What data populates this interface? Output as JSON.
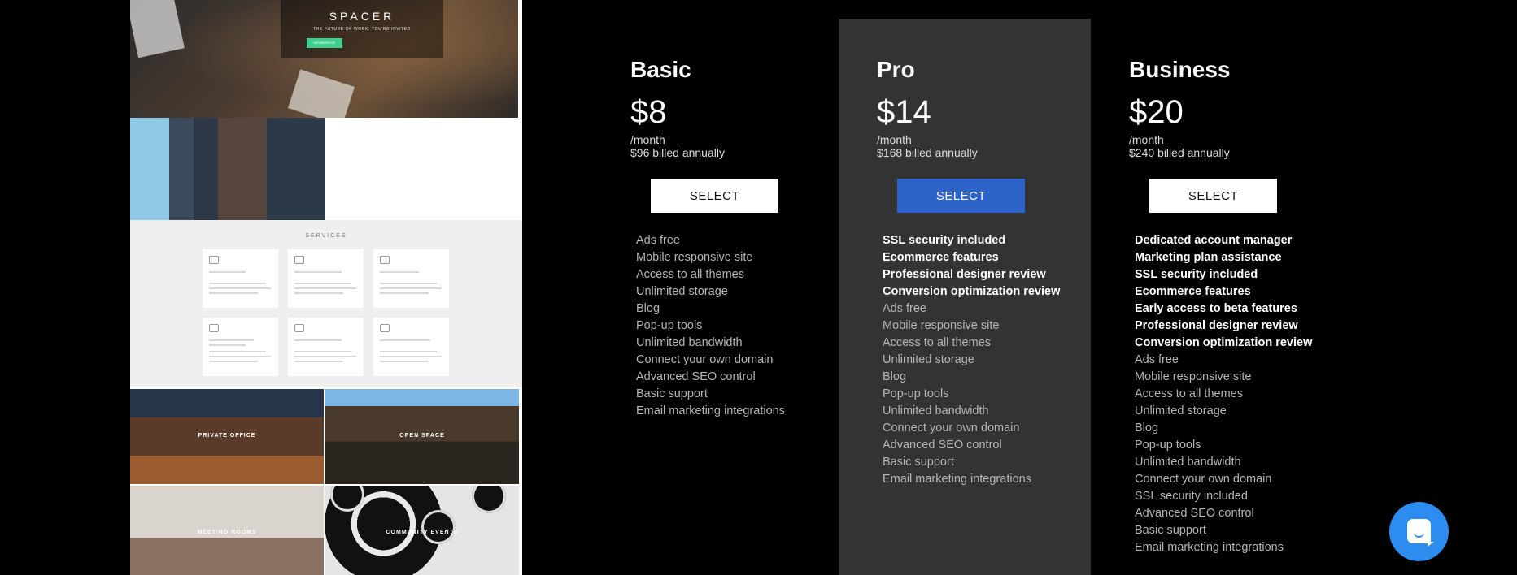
{
  "preview": {
    "brand": "SPACER",
    "tagline": "THE FUTURE OF WORK. YOU'RE INVITED",
    "cta": "MEMBERSHIP",
    "services_heading": "SERVICES",
    "tiles": [
      "PRIVATE OFFICE",
      "OPEN SPACE",
      "MEETING ROOMS",
      "COMMUNITY EVENTS"
    ]
  },
  "plans": [
    {
      "name": "Basic",
      "price": "$8",
      "per": "/month",
      "billed": "$96 billed annually",
      "button": "SELECT",
      "features_highlight": [],
      "features": [
        "Ads free",
        "Mobile responsive site",
        "Access to all themes",
        "Unlimited storage",
        "Blog",
        "Pop-up tools",
        "Unlimited bandwidth",
        "Connect your own domain",
        "Advanced SEO control",
        "Basic support",
        "Email marketing integrations"
      ]
    },
    {
      "name": "Pro",
      "price": "$14",
      "per": "/month",
      "billed": "$168 billed annually",
      "button": "SELECT",
      "features_highlight": [
        "SSL security included",
        "Ecommerce features",
        "Professional designer review",
        "Conversion optimization review"
      ],
      "features": [
        "Ads free",
        "Mobile responsive site",
        "Access to all themes",
        "Unlimited storage",
        "Blog",
        "Pop-up tools",
        "Unlimited bandwidth",
        "Connect your own domain",
        "Advanced SEO control",
        "Basic support",
        "Email marketing integrations"
      ]
    },
    {
      "name": "Business",
      "price": "$20",
      "per": "/month",
      "billed": "$240 billed annually",
      "button": "SELECT",
      "features_highlight": [
        "Dedicated account manager",
        "Marketing plan assistance",
        "SSL security included",
        "Ecommerce features",
        "Early access to beta features",
        "Professional designer review",
        "Conversion optimization review"
      ],
      "features": [
        "Ads free",
        "Mobile responsive site",
        "Access to all themes",
        "Unlimited storage",
        "Blog",
        "Pop-up tools",
        "Unlimited bandwidth",
        "Connect your own domain",
        "SSL security included",
        "Advanced SEO control",
        "Basic support",
        "Email marketing integrations"
      ]
    }
  ],
  "colors": {
    "page_bg": "#000000",
    "pro_panel": "#333333",
    "primary_button": "#2d63c8",
    "chat_button": "#2d8cf0"
  },
  "chat": {
    "icon": "chat-icon"
  }
}
